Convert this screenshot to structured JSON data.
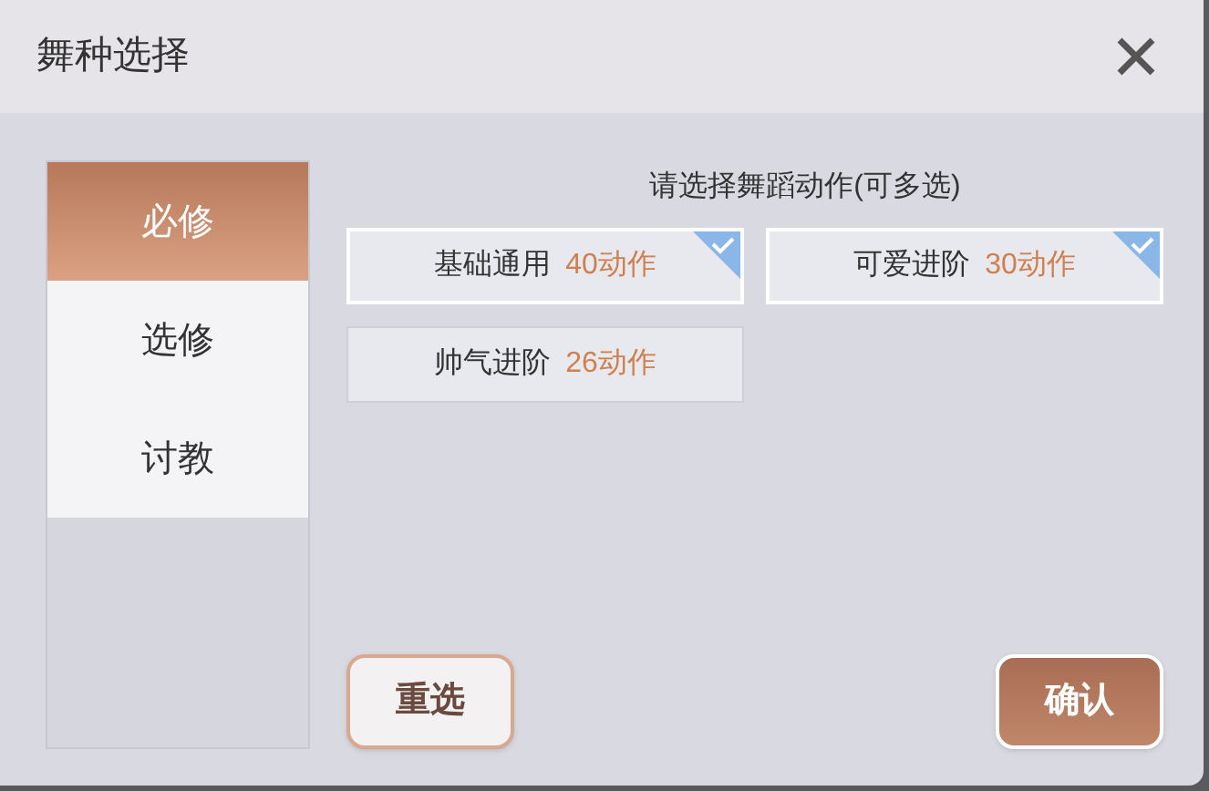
{
  "window": {
    "title": "舞种选择"
  },
  "sidebar": {
    "items": [
      {
        "label": "必修",
        "selected": true
      },
      {
        "label": "选修",
        "selected": false
      },
      {
        "label": "讨教",
        "selected": false
      }
    ]
  },
  "instruction": "请选择舞蹈动作(可多选)",
  "options": [
    {
      "name": "基础通用",
      "count": "40动作",
      "checked": true
    },
    {
      "name": "可爱进阶",
      "count": "30动作",
      "checked": true
    },
    {
      "name": "帅气进阶",
      "count": "26动作",
      "checked": false
    }
  ],
  "buttons": [
    {
      "label": "重选",
      "kind": "secondary"
    },
    {
      "label": "确认",
      "kind": "primary"
    }
  ]
}
